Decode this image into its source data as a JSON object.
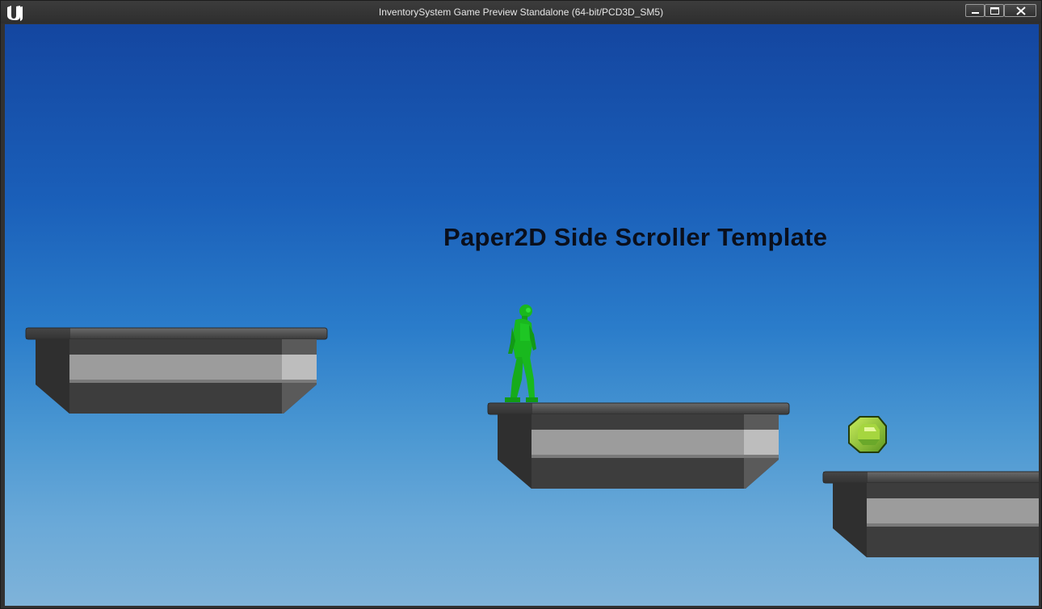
{
  "window": {
    "title": "InventorySystem Game Preview Standalone (64-bit/PCD3D_SM5)",
    "controls": [
      "minimize",
      "maximize",
      "close"
    ]
  },
  "game": {
    "title": "Paper2D Side Scroller Template",
    "sky_colors": [
      "#1446a0",
      "#7fb3d9"
    ],
    "platform_color": "#4a4a4a",
    "player_color": "#19b81e",
    "gem_color": "#8cc83c"
  }
}
